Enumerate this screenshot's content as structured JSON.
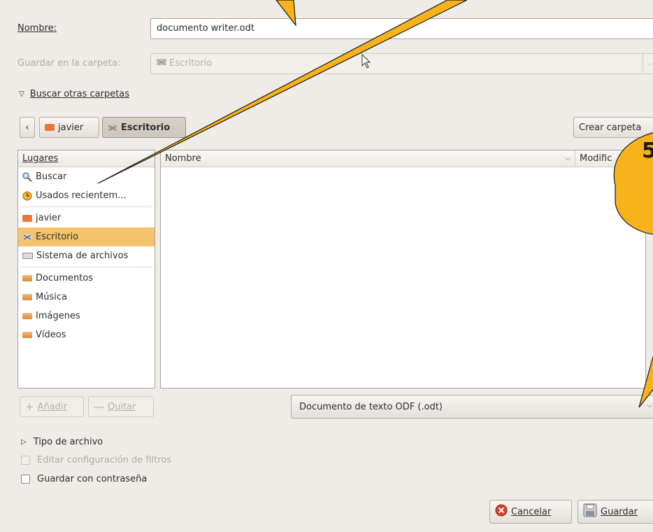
{
  "dialog": {
    "name_label": "Nombre:",
    "name_value": "documento writer.odt",
    "folder_label": "Guardar en la carpeta:",
    "folder_value": "Escritorio",
    "browse_label": "Buscar otras carpetas",
    "back_arrow": "‹",
    "path_home": "javier",
    "path_current": "Escritorio",
    "create_folder": "Crear carpeta"
  },
  "places": {
    "header": "Lugares",
    "items": [
      {
        "label": "Buscar",
        "icon": "search-icon"
      },
      {
        "label": "Usados recientem...",
        "icon": "clock-icon"
      },
      {
        "label": "javier",
        "icon": "home-folder-icon"
      },
      {
        "label": "Escritorio",
        "icon": "desktop-icon"
      },
      {
        "label": "Sistema de archivos",
        "icon": "disk-icon"
      },
      {
        "label": "Documentos",
        "icon": "folder-icon"
      },
      {
        "label": "Música",
        "icon": "folder-icon"
      },
      {
        "label": "Imágenes",
        "icon": "folder-icon"
      },
      {
        "label": "Vídeos",
        "icon": "folder-icon"
      }
    ],
    "add_label": "Añadir",
    "remove_label": "Quitar"
  },
  "files": {
    "col_name": "Nombre",
    "col_modified": "Modific"
  },
  "filter": {
    "value": "Documento de texto ODF (.odt)"
  },
  "options": {
    "file_type": "Tipo de archivo",
    "edit_filters": "Editar configuración de filtros",
    "save_password": "Guardar con contraseña"
  },
  "actions": {
    "cancel": "Cancelar",
    "save": "Guardar"
  },
  "callout": {
    "number": "5"
  },
  "colors": {
    "selection": "#f4c46c",
    "callout_fill": "#f8b31a",
    "dialog_bg": "#efebe7"
  }
}
